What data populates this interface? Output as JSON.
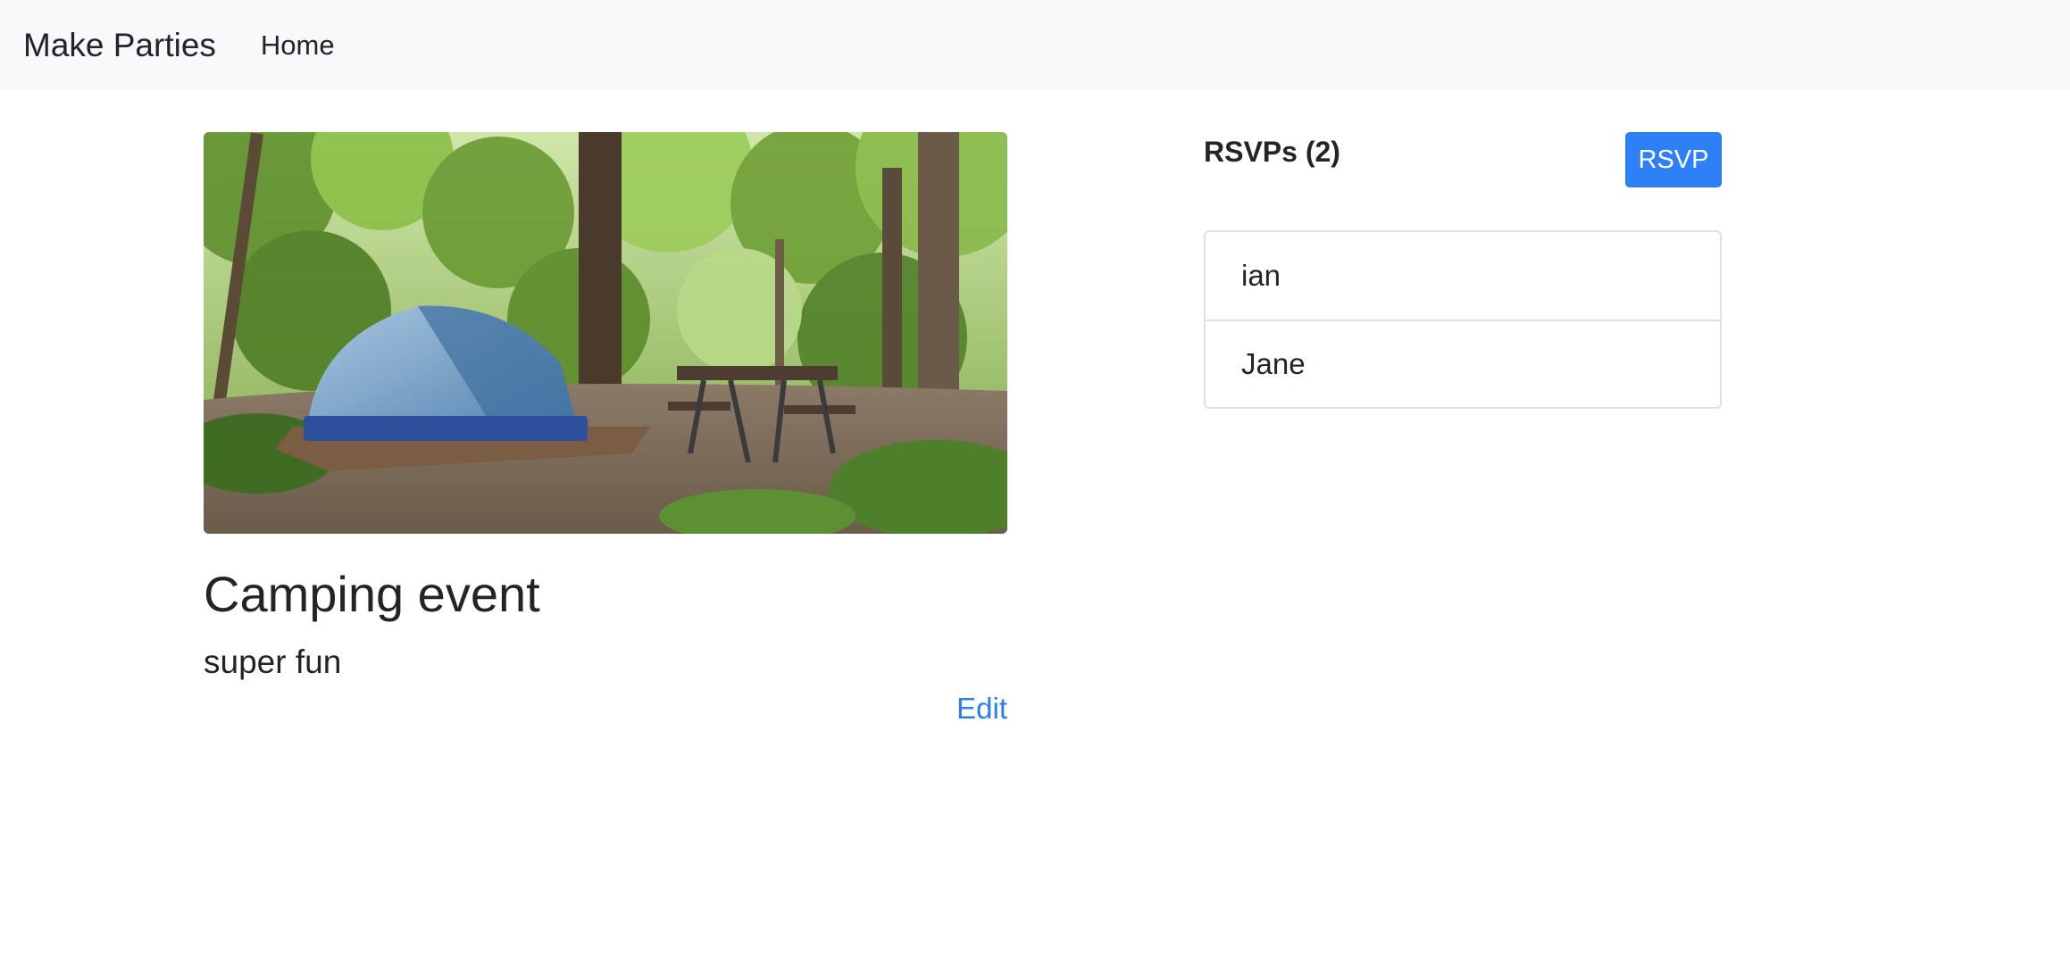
{
  "navbar": {
    "brand": "Make Parties",
    "links": [
      {
        "label": "Home"
      }
    ]
  },
  "event": {
    "title": "Camping event",
    "description": "super fun",
    "edit_label": "Edit"
  },
  "rsvps": {
    "heading": "RSVPs (2)",
    "button_label": "RSVP",
    "attendees": [
      {
        "name": "ian"
      },
      {
        "name": "Jane"
      }
    ]
  },
  "colors": {
    "accent": "#2e80f6",
    "link": "#2e7dec",
    "navbar_bg": "#f8f9fa"
  }
}
